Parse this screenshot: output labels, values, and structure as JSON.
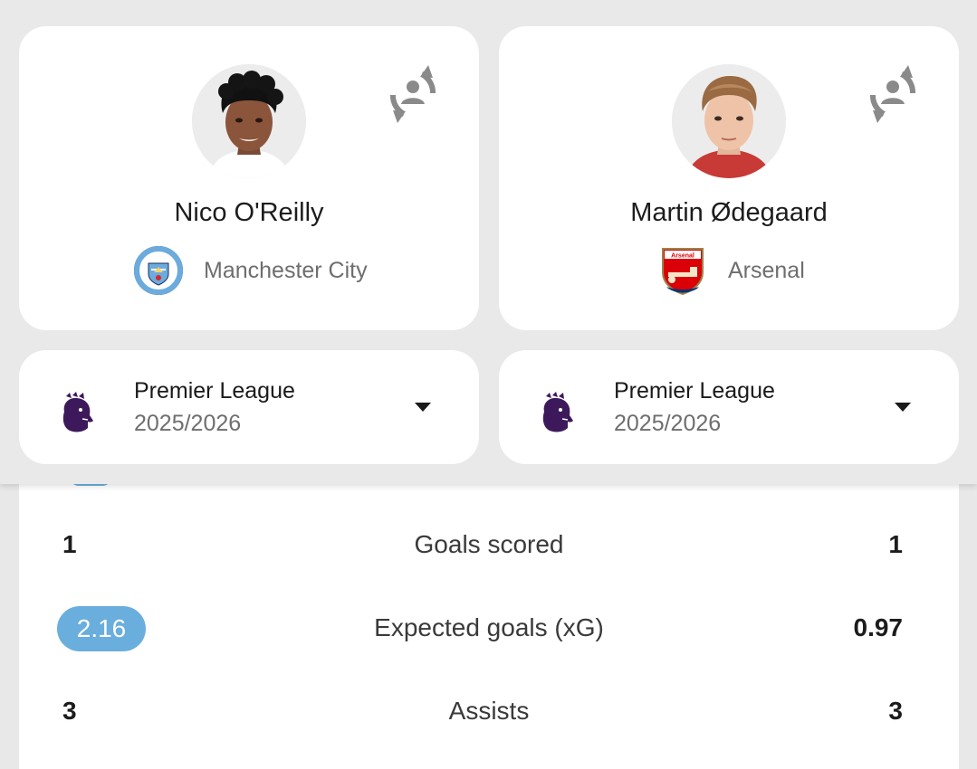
{
  "players": [
    {
      "name": "Nico O'Reilly",
      "club": "Manchester City",
      "club_badge_icon": "manchester-city-badge",
      "league": "Premier League",
      "season": "2025/2026"
    },
    {
      "name": "Martin Ødegaard",
      "club": "Arsenal",
      "club_badge_icon": "arsenal-badge",
      "league": "Premier League",
      "season": "2025/2026"
    }
  ],
  "badge_text": {
    "arsenal": "Arsenal"
  },
  "stats": [
    {
      "label": "Goals scored",
      "left": "1",
      "right": "1",
      "highlight": "none"
    },
    {
      "label": "Expected goals (xG)",
      "left": "2.16",
      "right": "0.97",
      "highlight": "left"
    },
    {
      "label": "Assists",
      "left": "3",
      "right": "3",
      "highlight": "none"
    }
  ],
  "colors": {
    "highlight": "#6aaedd",
    "premier_league_purple": "#3d195b",
    "background": "#e8e8e8",
    "card": "#ffffff",
    "icon_gray": "#8a8a8a"
  },
  "icons": {
    "swap": "swap-player-icon",
    "dropdown": "caret-down-icon",
    "league": "premier-league-lion-icon"
  }
}
